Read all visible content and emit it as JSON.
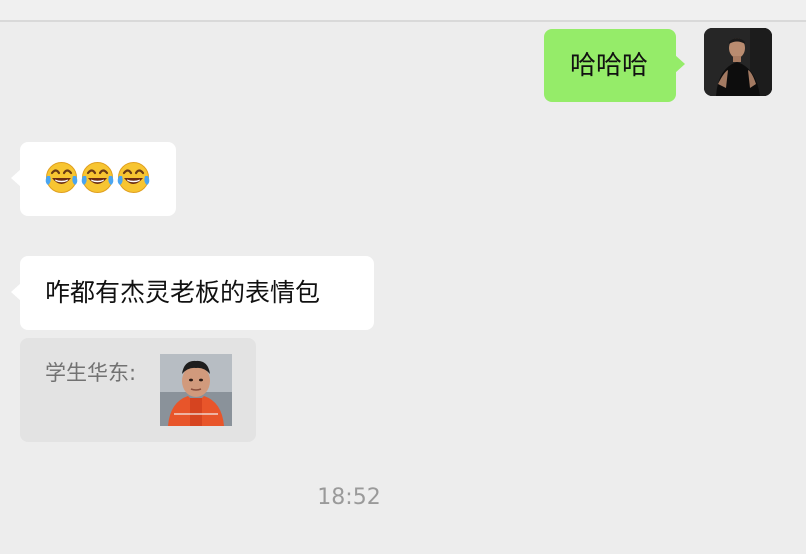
{
  "chat": {
    "messages": [
      {
        "from": "self",
        "text": "哈哈哈"
      },
      {
        "from": "other",
        "emoji": [
          "😂",
          "😂",
          "😂"
        ],
        "emoji_icon": "face-with-tears-of-joy"
      },
      {
        "from": "other",
        "text": "咋都有杰灵老板的表情包"
      }
    ],
    "quote": {
      "sender": "学生华东:",
      "thumbnail_icon": "face-photo"
    },
    "timestamp": "18:52"
  },
  "colors": {
    "background": "#ededed",
    "outgoing_bubble": "#95ec69",
    "incoming_bubble": "#ffffff",
    "quote_card": "#e3e3e3",
    "timestamp_text": "#9a9a9a"
  }
}
